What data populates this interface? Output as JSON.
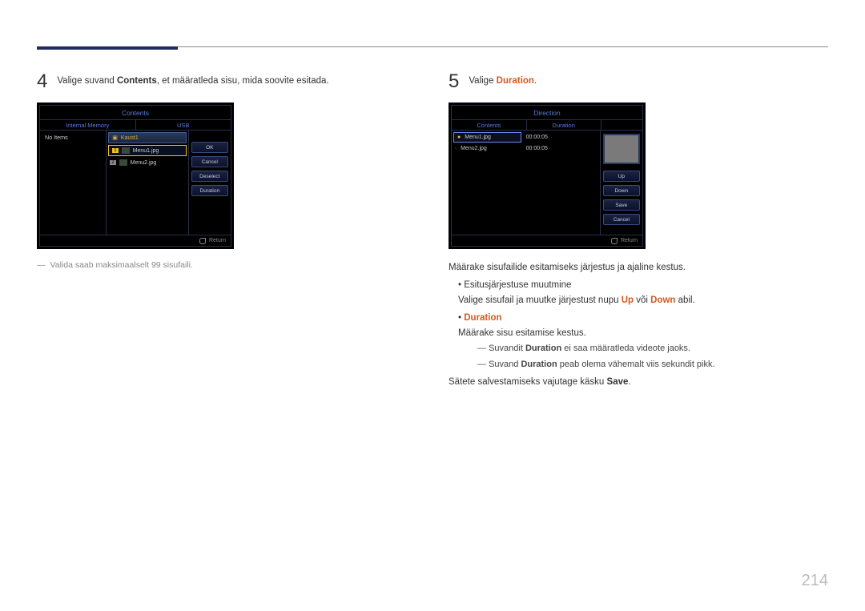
{
  "pageNumber": "214",
  "step4": {
    "number": "4",
    "text_pre": "Valige suvand ",
    "contents": "Contents",
    "text_post": ", et määratleda sisu, mida soovite esitada.",
    "note": "Valida saab maksimaalselt 99 sisufaili."
  },
  "step5": {
    "number": "5",
    "text_pre": "Valige ",
    "duration": "Duration",
    "period": "."
  },
  "screen1": {
    "title": "Contents",
    "tab1": "Internal Memory",
    "tab2": "USB",
    "noItems": "No Items",
    "folder": "Kaust1",
    "file1_num": "1",
    "file1": "Menu1.jpg",
    "file2_num": "2",
    "file2": "Menu2.jpg",
    "btnOk": "OK",
    "btnCancel": "Cancel",
    "btnDeselect": "Deselect",
    "btnDuration": "Duration",
    "return": "Return"
  },
  "screen2": {
    "title": "Direction",
    "tab1": "Contents",
    "tab2": "Duration",
    "file1": "Menu1.jpg",
    "dur1": "00:00:05",
    "file2": "Menu2.jpg",
    "dur2": "00:00:05",
    "btnUp": "Up",
    "btnDown": "Down",
    "btnSave": "Save",
    "btnCancel": "Cancel",
    "return": "Return"
  },
  "body": {
    "intro": "Määrake sisufailide esitamiseks järjestus ja ajaline kestus.",
    "bul1_title": "Esitusjärjestuse muutmine",
    "bul1_line_pre": "Valige sisufail ja muutke järjestust nupu ",
    "up": "Up",
    "or": " või ",
    "down": "Down",
    "bul1_line_post": " abil.",
    "bul2_title": "Duration",
    "bul2_line": "Määrake sisu esitamise kestus.",
    "sub1_pre": "Suvandit ",
    "sub1_post": " ei saa määratleda videote jaoks.",
    "sub2_pre": "Suvand ",
    "sub2_post": " peab olema vähemalt viis sekundit pikk.",
    "save_pre": "Sätete salvestamiseks vajutage käsku ",
    "save": "Save",
    "save_post": "."
  }
}
